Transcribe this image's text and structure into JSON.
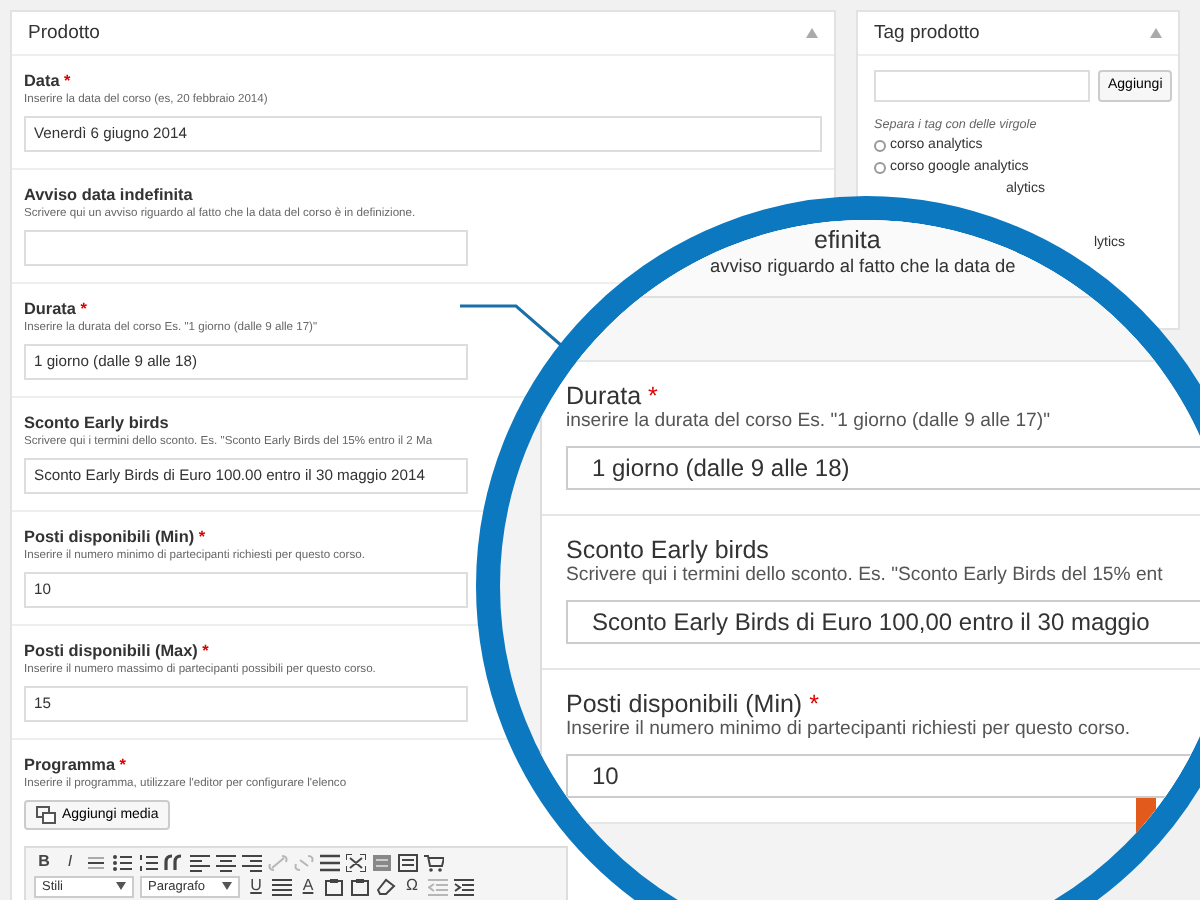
{
  "product_panel": {
    "title": "Prodotto",
    "fields": [
      {
        "label": "Data",
        "required_mark": "*",
        "hint": "Inserire la data del corso (es, 20 febbraio 2014)",
        "value": "Venerdì 6 giugno 2014"
      },
      {
        "label": "Avviso data indefinita",
        "hint": "Scrivere qui un avviso riguardo al fatto che la data del corso è in definizione."
      },
      {
        "label": "Durata",
        "required_mark": "*",
        "hint": "Inserire la durata del corso Es. \"1 giorno (dalle 9 alle 17)\"",
        "value": "1 giorno (dalle 9 alle 18)"
      },
      {
        "label": "Sconto Early birds",
        "hint": "Scrivere qui i termini dello sconto. Es. \"Sconto Early Birds del 15% entro il 2 Ma",
        "value": "Sconto Early Birds di Euro 100.00 entro il 30 maggio 2014"
      },
      {
        "label": "Posti disponibili (Min)",
        "required_mark": "*",
        "hint": "Inserire il numero minimo di partecipanti richiesti per questo corso.",
        "value": "10"
      },
      {
        "label": "Posti disponibili (Max)",
        "required_mark": "*",
        "hint": "Inserire il numero massimo di partecipanti possibili per questo corso.",
        "value": "15"
      }
    ],
    "program": {
      "label": "Programma",
      "required_mark": "*",
      "hint": "Inserire il programma, utilizzare l'editor per configurare l'elenco",
      "media_button": "Aggiungi media",
      "toolbar_rows": [
        [
          {
            "kind": "bold",
            "text": "B",
            "disabled": false
          },
          {
            "kind": "italic",
            "text": "I",
            "disabled": false
          },
          {
            "kind": "strike",
            "disabled": false
          },
          {
            "kind": "bullets",
            "disabled": false
          },
          {
            "kind": "numbers",
            "disabled": false
          },
          {
            "kind": "quote",
            "disabled": false
          },
          {
            "kind": "align-left",
            "disabled": false
          },
          {
            "kind": "align-center",
            "disabled": false
          },
          {
            "kind": "align-right",
            "disabled": false
          },
          {
            "kind": "link",
            "disabled": true
          },
          {
            "kind": "unlink",
            "disabled": true
          },
          {
            "kind": "more",
            "disabled": false
          },
          {
            "kind": "fullscreen",
            "disabled": false
          },
          {
            "kind": "kitchen",
            "disabled": false
          },
          {
            "kind": "form",
            "disabled": false
          },
          {
            "kind": "cart",
            "disabled": false
          }
        ],
        [
          {
            "kind": "select",
            "text": "Stili",
            "disabled": false
          },
          {
            "kind": "select",
            "text": "Paragrafo",
            "disabled": false
          },
          {
            "kind": "underline",
            "text": "U",
            "disabled": false
          },
          {
            "kind": "justify",
            "disabled": false
          },
          {
            "kind": "color",
            "text": "A",
            "disabled": false
          },
          {
            "kind": "paste",
            "disabled": false
          },
          {
            "kind": "paste",
            "disabled": false
          },
          {
            "kind": "eraser",
            "disabled": false
          },
          {
            "kind": "symbol",
            "text": "Ω",
            "disabled": false
          },
          {
            "kind": "outdent",
            "disabled": true
          },
          {
            "kind": "indent",
            "disabled": false
          }
        ]
      ]
    }
  },
  "tag_panel": {
    "title": "Tag prodotto",
    "add_button": "Aggiungi",
    "note": "Separa i tag con delle virgole",
    "tags": [
      {
        "text": "corso analytics",
        "kind": "full"
      },
      {
        "text": "corso google analytics",
        "kind": "full"
      },
      {
        "text": "alytics",
        "kind": "partial"
      },
      {
        "text": "lytics",
        "kind": "partial"
      }
    ]
  },
  "magnifier": {
    "fragments": [
      "efinita",
      "avviso riguardo al fatto che la data de"
    ],
    "fields": [
      {
        "label": "Durata",
        "required_mark": "*",
        "hint": "inserire la durata del corso Es. \"1 giorno (dalle 9 alle 17)\"",
        "value": "1 giorno (dalle 9 alle 18)"
      },
      {
        "label": "Sconto Early birds",
        "hint": "Scrivere qui i termini dello sconto. Es. \"Sconto Early Birds del 15% ent",
        "value": "Sconto Early Birds di Euro 100,00 entro il 30 maggio"
      },
      {
        "label": "Posti disponibili (Min)",
        "required_mark": "*",
        "hint": "Inserire il numero minimo di partecipanti richiesti per questo corso.",
        "value": "10"
      }
    ]
  }
}
